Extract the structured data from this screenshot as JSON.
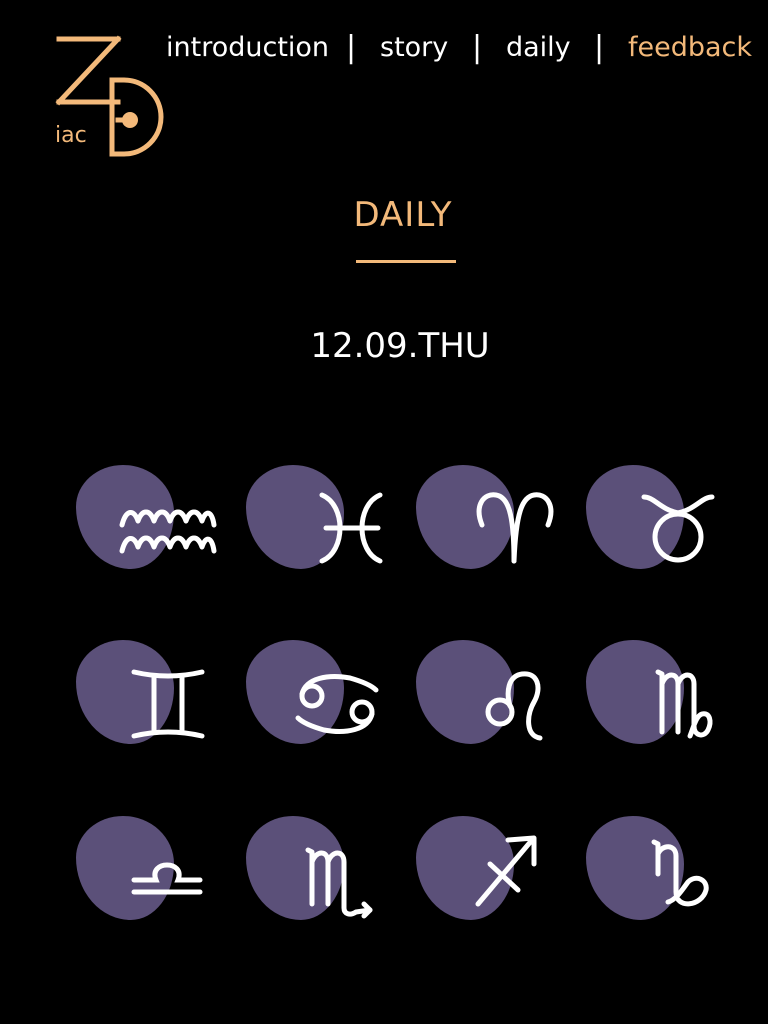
{
  "logo": {
    "letters": "ZD",
    "subtext": "iac",
    "color": "#f3b97a"
  },
  "nav": {
    "items": [
      {
        "label": "introduction",
        "active": false
      },
      {
        "label": "story",
        "active": false
      },
      {
        "label": "daily",
        "active": false
      },
      {
        "label": "feedback",
        "active": true
      }
    ],
    "separator": "|",
    "active_color": "#f3b97a",
    "color": "#ffffff"
  },
  "page": {
    "title": "DAILY",
    "date": "12.09.THU"
  },
  "colors": {
    "background": "#000000",
    "accent": "#f3b97a",
    "blob": "#5b5079",
    "glyph": "#ffffff"
  },
  "signs": [
    {
      "name": "aquarius",
      "icon": "aquarius-icon"
    },
    {
      "name": "pisces",
      "icon": "pisces-icon"
    },
    {
      "name": "aries",
      "icon": "aries-icon"
    },
    {
      "name": "taurus",
      "icon": "taurus-icon"
    },
    {
      "name": "gemini",
      "icon": "gemini-icon"
    },
    {
      "name": "cancer",
      "icon": "cancer-icon"
    },
    {
      "name": "leo",
      "icon": "leo-icon"
    },
    {
      "name": "virgo",
      "icon": "virgo-icon"
    },
    {
      "name": "libra",
      "icon": "libra-icon"
    },
    {
      "name": "scorpio",
      "icon": "scorpio-icon"
    },
    {
      "name": "sagittarius",
      "icon": "sagittarius-icon"
    },
    {
      "name": "capricorn",
      "icon": "capricorn-icon"
    }
  ]
}
